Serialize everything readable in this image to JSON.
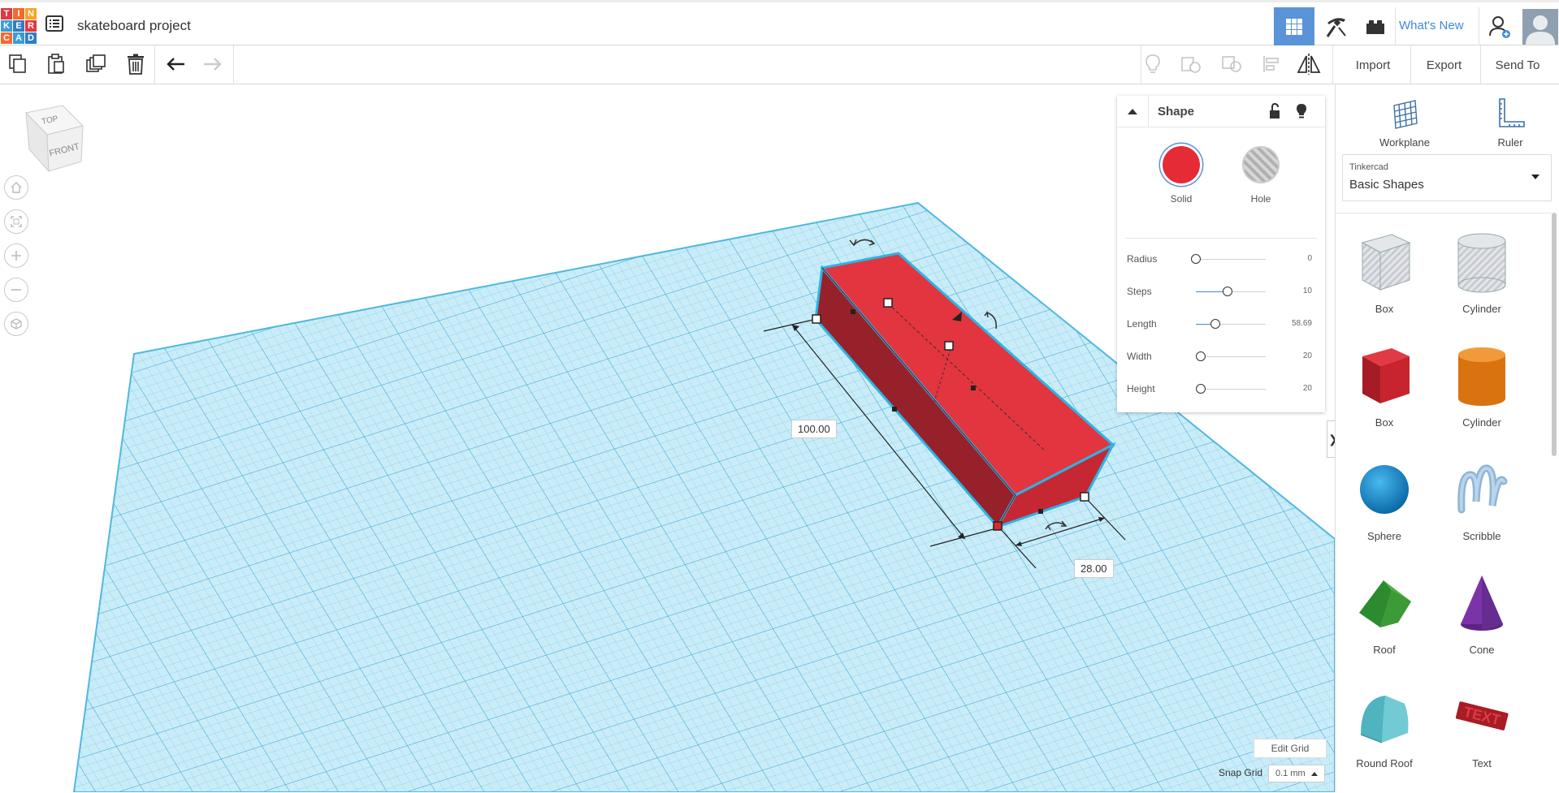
{
  "app": {
    "logo_letters": [
      "T",
      "I",
      "N",
      "K",
      "E",
      "R",
      "C",
      "A",
      "D"
    ],
    "project_title": "skateboard project",
    "whats_new": "What's New"
  },
  "toolbar": {
    "import_label": "Import",
    "export_label": "Export",
    "send_to_label": "Send To"
  },
  "viewcube": {
    "top": "TOP",
    "front": "FRONT"
  },
  "dimensions": {
    "length_value": "100.00",
    "width_value": "28.00"
  },
  "inspector": {
    "title": "Shape",
    "solid_label": "Solid",
    "hole_label": "Hole",
    "solid_color": "#e52b36",
    "properties": [
      {
        "name": "Radius",
        "value": "0",
        "level": 0.0
      },
      {
        "name": "Steps",
        "value": "10",
        "level": 0.45
      },
      {
        "name": "Length",
        "value": "58.69",
        "level": 0.28
      },
      {
        "name": "Width",
        "value": "20",
        "level": 0.07
      },
      {
        "name": "Height",
        "value": "20",
        "level": 0.07
      }
    ]
  },
  "right_panel": {
    "workplane_label": "Workplane",
    "ruler_label": "Ruler",
    "library_small": "Tinkercad",
    "library_name": "Basic Shapes",
    "shapes": [
      {
        "label": "Box",
        "icon": "box-hole-icon"
      },
      {
        "label": "Cylinder",
        "icon": "cylinder-hole-icon"
      },
      {
        "label": "Box",
        "icon": "box-icon"
      },
      {
        "label": "Cylinder",
        "icon": "cylinder-icon"
      },
      {
        "label": "Sphere",
        "icon": "sphere-icon"
      },
      {
        "label": "Scribble",
        "icon": "scribble-icon"
      },
      {
        "label": "Roof",
        "icon": "roof-icon"
      },
      {
        "label": "Cone",
        "icon": "cone-icon"
      },
      {
        "label": "Round Roof",
        "icon": "round-roof-icon"
      },
      {
        "label": "Text",
        "icon": "text-icon"
      }
    ]
  },
  "grid_controls": {
    "edit_grid_label": "Edit Grid",
    "snap_grid_label": "Snap Grid",
    "snap_value": "0.1 mm"
  },
  "colors": {
    "accent": "#5b93d8",
    "link": "#3f8ad8",
    "workplane": "#aee0f2",
    "shape": "#d93340"
  }
}
